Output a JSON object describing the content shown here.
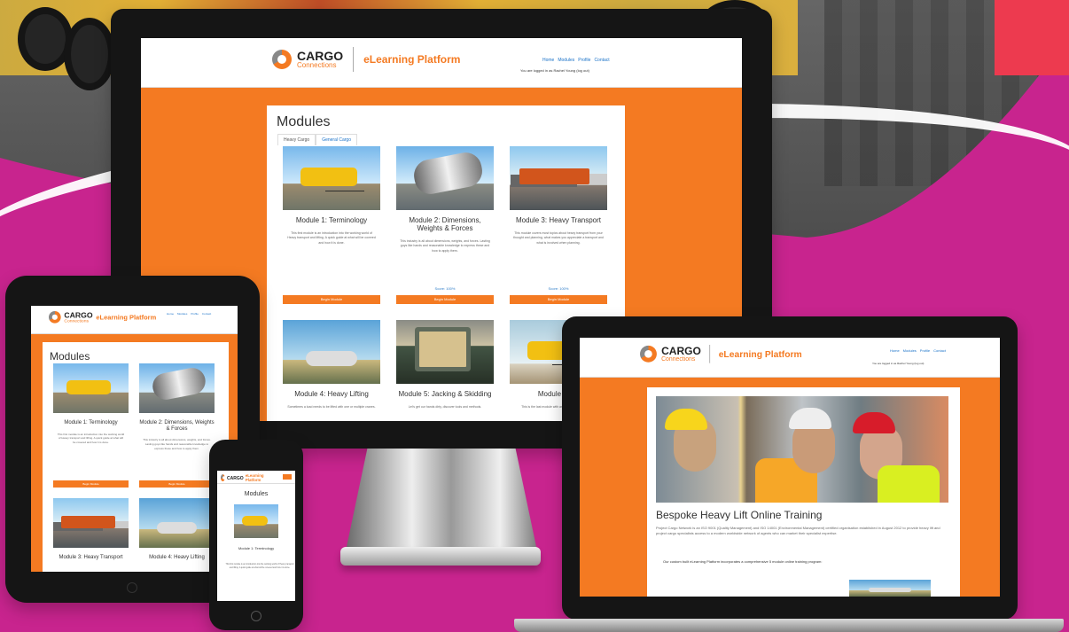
{
  "brand": {
    "name": "CARGO",
    "subtitle": "Connections",
    "platform": "eLearning Platform"
  },
  "nav": {
    "home": "Home",
    "modules": "Modules",
    "profile": "Profile",
    "contact": "Contact",
    "login_status": "You are logged in as Rachel Young (log out)"
  },
  "modules_page": {
    "title": "Modules",
    "tabs": [
      "Heavy Cargo",
      "General Cargo"
    ]
  },
  "modules": [
    {
      "title": "Module 1: Terminology",
      "description": "This first module is an introduction into the working world of Heavy transport and lifting. A quick guide at what will be covered and how it is done.",
      "score": "",
      "button": "Begin Module"
    },
    {
      "title": "Module 2: Dimensions, Weights & Forces",
      "description": "This industry is all about dimensions, weights, and forces. Lasting guys like hands and reasonable knowledge to express these and how to apply them.",
      "score": "Score: 100%",
      "button": "Begin Module"
    },
    {
      "title": "Module 3: Heavy Transport",
      "description": "This module covers most topics about heavy transport from your thought and planning, what makes you appreciate a transport and what is involved when planning.",
      "score": "Score: 100%",
      "button": "Begin Module"
    },
    {
      "title": "Module 4: Heavy Lifting",
      "description": "Sometimes a load needs to be lifted with one or multiple cranes.",
      "score": "",
      "button": ""
    },
    {
      "title": "Module 5: Jacking & Skidding",
      "description": "Let's get our hands dirty, discover tools and methods.",
      "score": "",
      "button": ""
    },
    {
      "title": "Module 6: Lo",
      "description": "This is the last module with an overview of operations.",
      "score": "",
      "button": ""
    }
  ],
  "laptop_page": {
    "title": "Bespoke Heavy Lift Online Training",
    "body": "Project Cargo Network is an ISO 9001 (Quality Management) and ISO 14001 (Environmental Management) certified organisation established in August 2012 to provide heavy lift and project cargo specialists access to a modern worldwide network of agents who can market their specialist expertise.",
    "callout": "Our custom built eLearning Platform incorporates a comprehensive 5 module online training program:"
  },
  "colors": {
    "magenta": "#c8248e",
    "orange": "#f47a22",
    "dark": "#151515",
    "link": "#1a72c8"
  }
}
